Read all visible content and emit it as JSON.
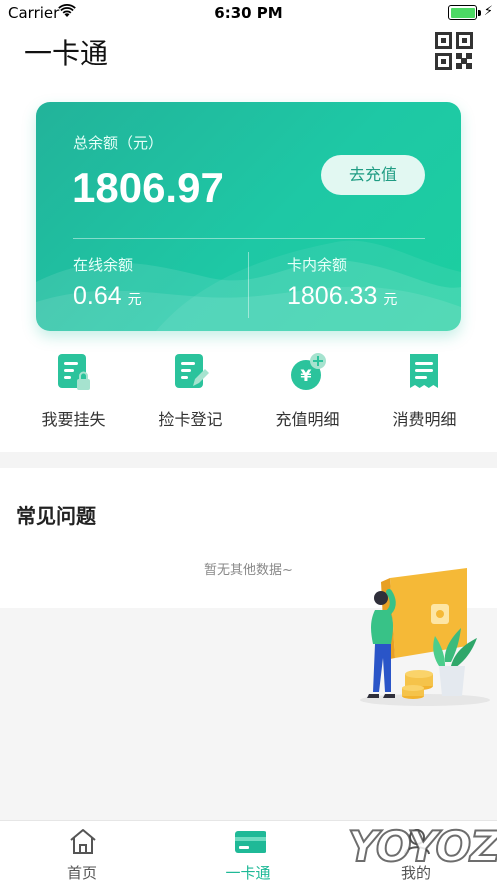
{
  "status_bar": {
    "carrier": "Carrier",
    "time": "6:30 PM"
  },
  "header": {
    "title": "一卡通",
    "qr_icon": "qr-code-icon"
  },
  "balance_card": {
    "total_label": "总余额（元）",
    "total_value": "1806.97",
    "recharge_label": "去充值",
    "online_label": "在线余额",
    "online_value": "0.64",
    "card_label": "卡内余额",
    "card_value": "1806.33",
    "unit": "元",
    "colors": {
      "from": "#22b39a",
      "to": "#1ccfa0"
    }
  },
  "actions": [
    {
      "label": "我要挂失",
      "icon": "report-loss-icon"
    },
    {
      "label": "捡卡登记",
      "icon": "found-card-register-icon"
    },
    {
      "label": "充值明细",
      "icon": "recharge-detail-icon"
    },
    {
      "label": "消费明细",
      "icon": "consumption-detail-icon"
    }
  ],
  "faq": {
    "title": "常见问题",
    "empty_text": "暂无其他数据~"
  },
  "tabbar": {
    "items": [
      {
        "label": "首页",
        "icon": "home-icon"
      },
      {
        "label": "一卡通",
        "icon": "card-icon"
      },
      {
        "label": "我的",
        "icon": "profile-icon"
      }
    ],
    "active_color": "#1fb997"
  },
  "watermark": "YOYOZ"
}
